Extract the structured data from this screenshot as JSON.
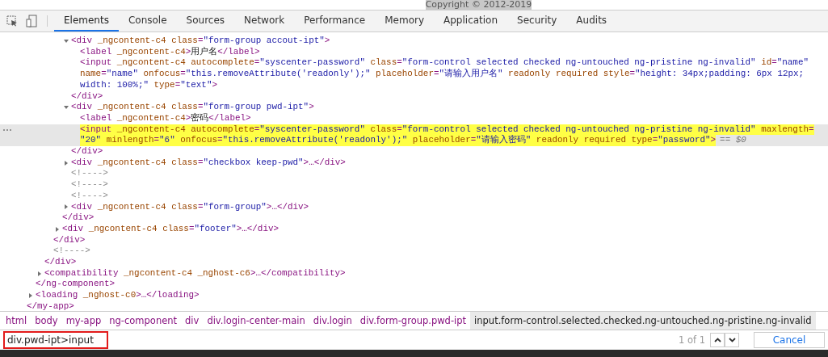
{
  "page_strip": {
    "text": "Copyright © 2012-2019"
  },
  "toolbar": {
    "tabs": [
      {
        "label": "Elements",
        "selected": true
      },
      {
        "label": "Console",
        "selected": false
      },
      {
        "label": "Sources",
        "selected": false
      },
      {
        "label": "Network",
        "selected": false
      },
      {
        "label": "Performance",
        "selected": false
      },
      {
        "label": "Memory",
        "selected": false
      },
      {
        "label": "Application",
        "selected": false
      },
      {
        "label": "Security",
        "selected": false
      },
      {
        "label": "Audits",
        "selected": false
      }
    ]
  },
  "dom_tree": [
    {
      "selected": false,
      "expanded": true,
      "close": [
        {
          "kind": "tag",
          "text": "</my-app>"
        }
      ],
      "children": [
        {
          "selected": false,
          "expanded": true,
          "close": [
            {
              "kind": "tag",
              "text": "</ng-component>"
            }
          ],
          "children": [
            {
              "selected": false,
              "expanded": true,
              "close": [
                {
                  "kind": "tag",
                  "text": "</div>"
                }
              ],
              "children": [
                {
                  "selected": false,
                  "expanded": true,
                  "close": [
                    {
                      "kind": "tag",
                      "text": "</div>"
                    }
                  ],
                  "children": [
                    {
                      "selected": false,
                      "expanded": true,
                      "close": [
                        {
                          "kind": "tag",
                          "text": "</div>"
                        }
                      ],
                      "children": [
                        {
                          "selected": false,
                          "expanded": true,
                          "open": [
                            [
                              {
                                "kind": "tag",
                                "text": "<div"
                              },
                              {
                                "kind": "attr",
                                "text": " _ngcontent-c4 class"
                              },
                              {
                                "kind": "tag",
                                "text": "="
                              },
                              {
                                "kind": "value",
                                "text": "\"form-group accout-ipt\""
                              },
                              {
                                "kind": "tag",
                                "text": ">"
                              }
                            ]
                          ],
                          "close": [
                            {
                              "kind": "tag",
                              "text": "</div>"
                            }
                          ],
                          "children": [
                            {
                              "selected": false,
                              "open": [
                                [
                                  {
                                    "kind": "tag",
                                    "text": "<label"
                                  },
                                  {
                                    "kind": "attr",
                                    "text": " _ngcontent-c4"
                                  },
                                  {
                                    "kind": "tag",
                                    "text": ">"
                                  },
                                  {
                                    "kind": "content",
                                    "text": "用户名"
                                  },
                                  {
                                    "kind": "tag",
                                    "text": "</label>"
                                  }
                                ]
                              ]
                            },
                            {
                              "selected": false,
                              "open": [
                                [
                                  {
                                    "kind": "tag",
                                    "text": "<input"
                                  },
                                  {
                                    "kind": "attr",
                                    "text": " _ngcontent-c4 autocomplete"
                                  },
                                  {
                                    "kind": "tag",
                                    "text": "="
                                  },
                                  {
                                    "kind": "value",
                                    "text": "\"syscenter-password\""
                                  },
                                  {
                                    "kind": "attr",
                                    "text": " class"
                                  },
                                  {
                                    "kind": "tag",
                                    "text": "="
                                  },
                                  {
                                    "kind": "value",
                                    "text": "\"form-control selected checked ng-untouched ng-pristine ng-invalid\""
                                  },
                                  {
                                    "kind": "attr",
                                    "text": " id"
                                  },
                                  {
                                    "kind": "tag",
                                    "text": "="
                                  },
                                  {
                                    "kind": "value",
                                    "text": "\"name\""
                                  }
                                ],
                                [
                                  {
                                    "kind": "attr",
                                    "text": "name"
                                  },
                                  {
                                    "kind": "tag",
                                    "text": "="
                                  },
                                  {
                                    "kind": "value",
                                    "text": "\"name\""
                                  },
                                  {
                                    "kind": "attr",
                                    "text": " onfocus"
                                  },
                                  {
                                    "kind": "tag",
                                    "text": "="
                                  },
                                  {
                                    "kind": "value",
                                    "text": "\"this.removeAttribute('readonly');\""
                                  },
                                  {
                                    "kind": "attr",
                                    "text": " placeholder"
                                  },
                                  {
                                    "kind": "tag",
                                    "text": "="
                                  },
                                  {
                                    "kind": "value",
                                    "text": "\"请输入用户名\""
                                  },
                                  {
                                    "kind": "attr",
                                    "text": " readonly required style"
                                  },
                                  {
                                    "kind": "tag",
                                    "text": "="
                                  },
                                  {
                                    "kind": "value",
                                    "text": "\"height: 34px;padding: 6px 12px;"
                                  }
                                ],
                                [
                                  {
                                    "kind": "value",
                                    "text": "width: 100%;\""
                                  },
                                  {
                                    "kind": "attr",
                                    "text": " type"
                                  },
                                  {
                                    "kind": "tag",
                                    "text": "="
                                  },
                                  {
                                    "kind": "value",
                                    "text": "\"text\""
                                  },
                                  {
                                    "kind": "tag",
                                    "text": ">"
                                  }
                                ]
                              ]
                            }
                          ]
                        },
                        {
                          "selected": false,
                          "expanded": true,
                          "open": [
                            [
                              {
                                "kind": "tag",
                                "text": "<div"
                              },
                              {
                                "kind": "attr",
                                "text": " _ngcontent-c4 class"
                              },
                              {
                                "kind": "tag",
                                "text": "="
                              },
                              {
                                "kind": "value",
                                "text": "\"form-group pwd-ipt\""
                              },
                              {
                                "kind": "tag",
                                "text": ">"
                              }
                            ]
                          ],
                          "close": [
                            {
                              "kind": "tag",
                              "text": "</div>"
                            }
                          ],
                          "children": [
                            {
                              "selected": false,
                              "open": [
                                [
                                  {
                                    "kind": "tag",
                                    "text": "<label"
                                  },
                                  {
                                    "kind": "attr",
                                    "text": " _ngcontent-c4"
                                  },
                                  {
                                    "kind": "tag",
                                    "text": ">"
                                  },
                                  {
                                    "kind": "content",
                                    "text": "密码"
                                  },
                                  {
                                    "kind": "tag",
                                    "text": "</label>"
                                  }
                                ]
                              ]
                            },
                            {
                              "selected": true,
                              "suffix": "== $0",
                              "open": [
                                [
                                  {
                                    "kind": "tag",
                                    "text": "<input"
                                  },
                                  {
                                    "kind": "attr",
                                    "text": " _ngcontent-c4 autocomplete"
                                  },
                                  {
                                    "kind": "tag",
                                    "text": "="
                                  },
                                  {
                                    "kind": "value",
                                    "text": "\"syscenter-password\""
                                  },
                                  {
                                    "kind": "attr",
                                    "text": " class"
                                  },
                                  {
                                    "kind": "tag",
                                    "text": "="
                                  },
                                  {
                                    "kind": "value",
                                    "text": "\"form-control selected checked ng-untouched ng-pristine ng-invalid\""
                                  },
                                  {
                                    "kind": "attr",
                                    "text": " maxlength"
                                  },
                                  {
                                    "kind": "tag",
                                    "text": "="
                                  }
                                ],
                                [
                                  {
                                    "kind": "value",
                                    "text": "\"20\""
                                  },
                                  {
                                    "kind": "attr",
                                    "text": " minlength"
                                  },
                                  {
                                    "kind": "tag",
                                    "text": "="
                                  },
                                  {
                                    "kind": "value",
                                    "text": "\"6\""
                                  },
                                  {
                                    "kind": "attr",
                                    "text": " onfocus"
                                  },
                                  {
                                    "kind": "tag",
                                    "text": "="
                                  },
                                  {
                                    "kind": "value",
                                    "text": "\"this.removeAttribute('readonly');\""
                                  },
                                  {
                                    "kind": "attr",
                                    "text": " placeholder"
                                  },
                                  {
                                    "kind": "tag",
                                    "text": "="
                                  },
                                  {
                                    "kind": "value",
                                    "text": "\"请输入密码\""
                                  },
                                  {
                                    "kind": "attr",
                                    "text": " readonly required type"
                                  },
                                  {
                                    "kind": "tag",
                                    "text": "="
                                  },
                                  {
                                    "kind": "value",
                                    "text": "\"password\""
                                  },
                                  {
                                    "kind": "tag",
                                    "text": ">"
                                  }
                                ]
                              ]
                            }
                          ]
                        },
                        {
                          "selected": false,
                          "expanded": false,
                          "open": [
                            [
                              {
                                "kind": "tag",
                                "text": "<div"
                              },
                              {
                                "kind": "attr",
                                "text": " _ngcontent-c4 class"
                              },
                              {
                                "kind": "tag",
                                "text": "="
                              },
                              {
                                "kind": "value",
                                "text": "\"checkbox keep-pwd\""
                              },
                              {
                                "kind": "tag",
                                "text": ">…</div>"
                              }
                            ]
                          ]
                        },
                        {
                          "selected": false,
                          "open": [
                            [
                              {
                                "kind": "comment",
                                "text": "<!---->"
                              }
                            ]
                          ]
                        },
                        {
                          "selected": false,
                          "open": [
                            [
                              {
                                "kind": "comment",
                                "text": "<!---->"
                              }
                            ]
                          ]
                        },
                        {
                          "selected": false,
                          "open": [
                            [
                              {
                                "kind": "comment",
                                "text": "<!---->"
                              }
                            ]
                          ]
                        },
                        {
                          "selected": false,
                          "expanded": false,
                          "open": [
                            [
                              {
                                "kind": "tag",
                                "text": "<div"
                              },
                              {
                                "kind": "attr",
                                "text": " _ngcontent-c4 class"
                              },
                              {
                                "kind": "tag",
                                "text": "="
                              },
                              {
                                "kind": "value",
                                "text": "\"form-group\""
                              },
                              {
                                "kind": "tag",
                                "text": ">…</div>"
                              }
                            ]
                          ]
                        }
                      ]
                    },
                    {
                      "selected": false,
                      "expanded": false,
                      "open": [
                        [
                          {
                            "kind": "tag",
                            "text": "<div"
                          },
                          {
                            "kind": "attr",
                            "text": " _ngcontent-c4 class"
                          },
                          {
                            "kind": "tag",
                            "text": "="
                          },
                          {
                            "kind": "value",
                            "text": "\"footer\""
                          },
                          {
                            "kind": "tag",
                            "text": ">…</div>"
                          }
                        ]
                      ]
                    }
                  ]
                },
                {
                  "selected": false,
                  "open": [
                    [
                      {
                        "kind": "comment",
                        "text": "<!---->"
                      }
                    ]
                  ]
                }
              ]
            },
            {
              "selected": false,
              "expanded": false,
              "open": [
                [
                  {
                    "kind": "tag",
                    "text": "<compatibility"
                  },
                  {
                    "kind": "attr",
                    "text": " _ngcontent-c4 _nghost-c6"
                  },
                  {
                    "kind": "tag",
                    "text": ">…</compatibility>"
                  }
                ]
              ]
            }
          ]
        },
        {
          "selected": false,
          "expanded": false,
          "open": [
            [
              {
                "kind": "tag",
                "text": "<loading"
              },
              {
                "kind": "attr",
                "text": " _nghost-c0"
              },
              {
                "kind": "tag",
                "text": ">…</loading>"
              }
            ]
          ]
        }
      ]
    }
  ],
  "breadcrumbs": [
    {
      "label": "html",
      "selected": false
    },
    {
      "label": "body",
      "selected": false
    },
    {
      "label": "my-app",
      "selected": false
    },
    {
      "label": "ng-component",
      "selected": false
    },
    {
      "label": "div",
      "selected": false
    },
    {
      "label": "div.login-center-main",
      "selected": false
    },
    {
      "label": "div.login",
      "selected": false
    },
    {
      "label": "div.form-group.pwd-ipt",
      "selected": false
    },
    {
      "label": "input.form-control.selected.checked.ng-untouched.ng-pristine.ng-invalid",
      "selected": true
    }
  ],
  "search": {
    "value": "div.pwd-ipt>input",
    "match_count": "1 of 1",
    "cancel": "Cancel"
  }
}
